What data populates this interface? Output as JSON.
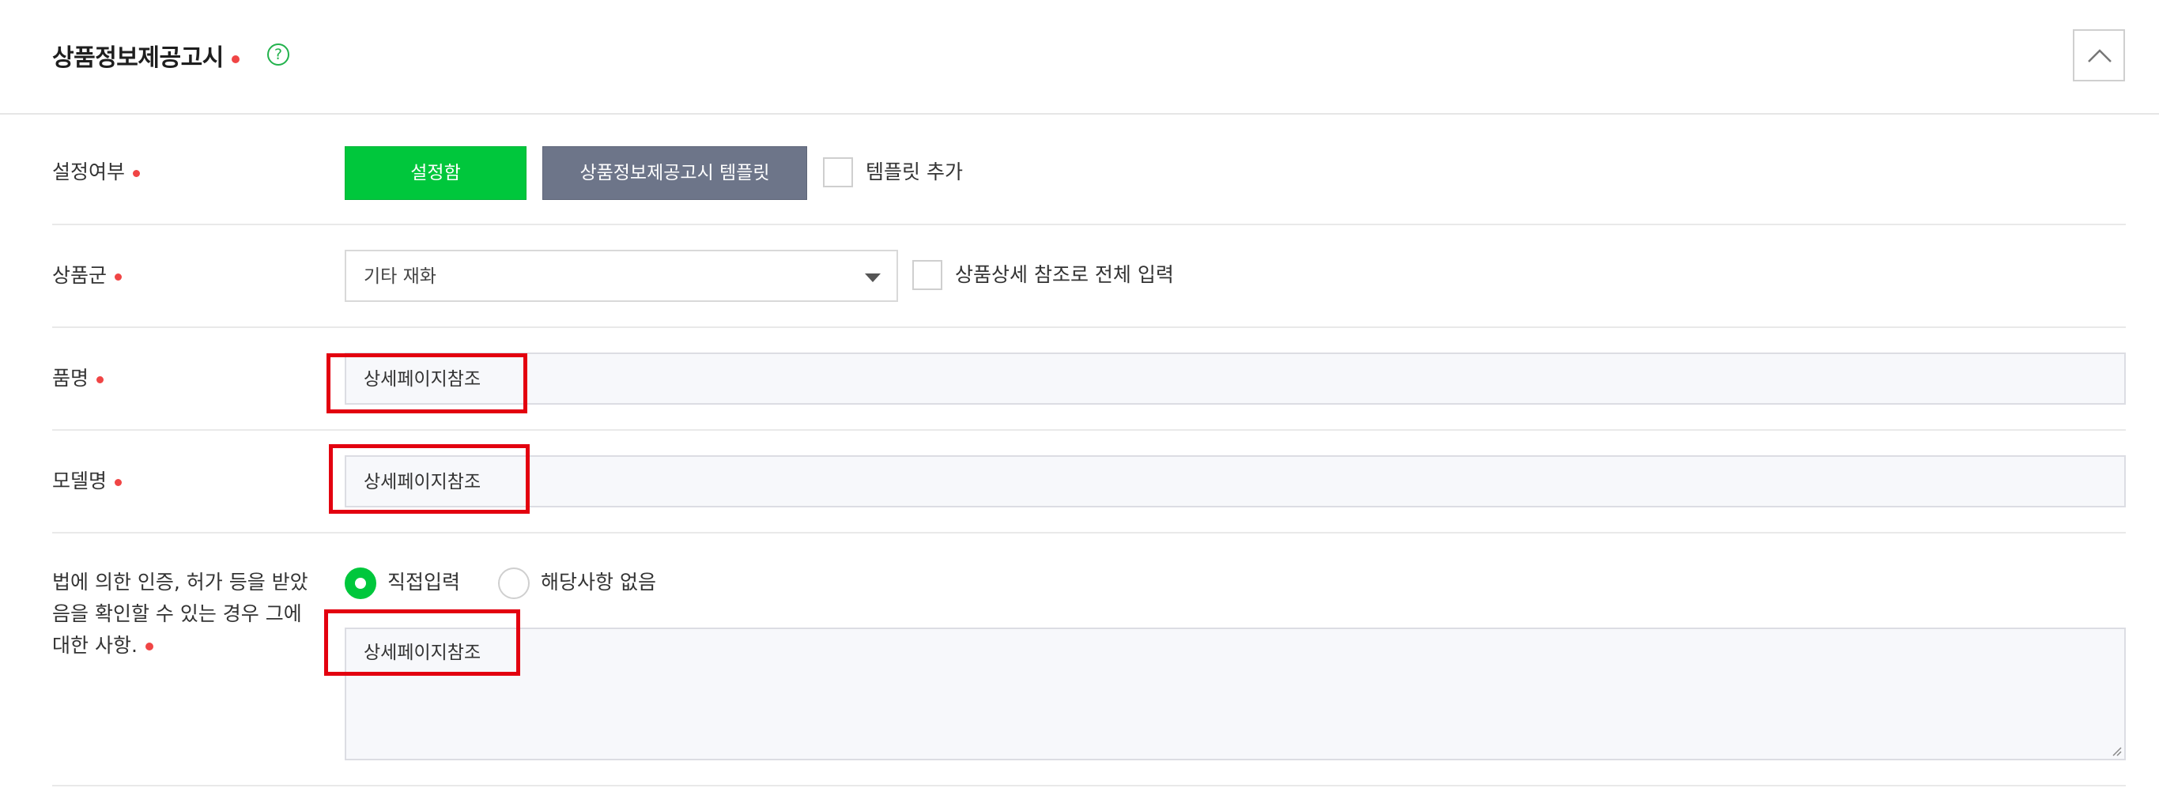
{
  "section": {
    "title": "상품정보제공고시",
    "help_glyph": "?",
    "collapse_icon": "chevron-up-icon",
    "colors": {
      "accent_green": "#00c73c",
      "template_button": "#6d7589",
      "required_dot": "#f04545",
      "highlight": "#e3000f"
    }
  },
  "setting": {
    "label": "설정여부",
    "set_button": "설정함",
    "template_button": "상품정보제공고시 템플릿",
    "add_template_label": "템플릿 추가"
  },
  "product_group": {
    "label": "상품군",
    "selected": "기타 재화",
    "detail_ref_label": "상품상세 참조로 전체 입력"
  },
  "item_name": {
    "label": "품명",
    "value": "상세페이지참조"
  },
  "model_name": {
    "label": "모델명",
    "value": "상세페이지참조"
  },
  "certification": {
    "label_lines": [
      "법에 의한 인증, 허가 등을 받았",
      "음을 확인할 수 있는 경우 그에",
      "대한 사항."
    ],
    "radio_direct": "직접입력",
    "radio_none": "해당사항 없음",
    "value": "상세페이지참조"
  }
}
